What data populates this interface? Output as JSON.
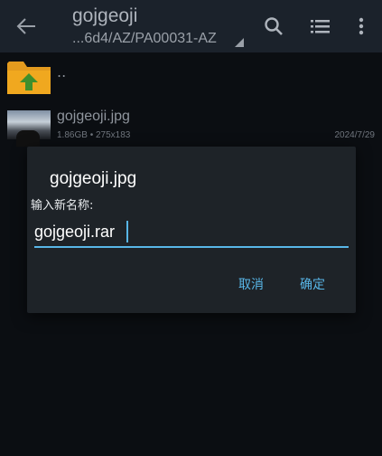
{
  "appbar": {
    "title": "gojgeoji",
    "path": "...6d4/AZ/PA00031-AZ",
    "icons": [
      "back-arrow-icon",
      "search-icon",
      "list-view-icon",
      "more-vert-icon"
    ]
  },
  "file_list": {
    "parent_label": "..",
    "items": [
      {
        "name": "gojgeoji.jpg",
        "meta": "1.86GB  •  275x183",
        "date": "2024/7/29"
      }
    ]
  },
  "dialog": {
    "title": "gojgeoji.jpg",
    "label": "输入新名称:",
    "input_value": "gojgeoji.rar",
    "cancel_label": "取消",
    "ok_label": "确定"
  },
  "colors": {
    "accent": "#58b6e7",
    "appbar": "#1b222b",
    "background": "#0b0e12",
    "dialog": "#1e2328",
    "folder": "#e39a1e",
    "up_arrow": "#3f8f2c"
  }
}
